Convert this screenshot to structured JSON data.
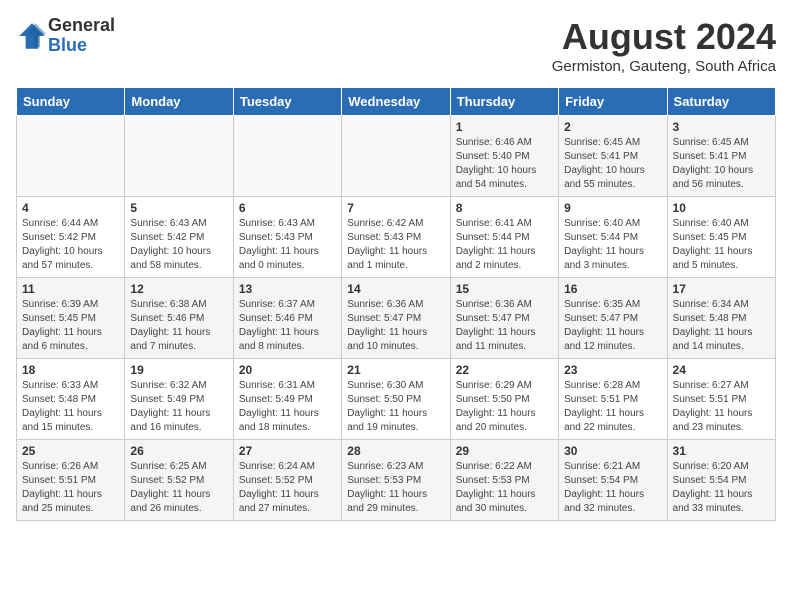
{
  "header": {
    "logo_general": "General",
    "logo_blue": "Blue",
    "month_year": "August 2024",
    "location": "Germiston, Gauteng, South Africa"
  },
  "days_of_week": [
    "Sunday",
    "Monday",
    "Tuesday",
    "Wednesday",
    "Thursday",
    "Friday",
    "Saturday"
  ],
  "weeks": [
    [
      {
        "day": "",
        "info": ""
      },
      {
        "day": "",
        "info": ""
      },
      {
        "day": "",
        "info": ""
      },
      {
        "day": "",
        "info": ""
      },
      {
        "day": "1",
        "info": "Sunrise: 6:46 AM\nSunset: 5:40 PM\nDaylight: 10 hours\nand 54 minutes."
      },
      {
        "day": "2",
        "info": "Sunrise: 6:45 AM\nSunset: 5:41 PM\nDaylight: 10 hours\nand 55 minutes."
      },
      {
        "day": "3",
        "info": "Sunrise: 6:45 AM\nSunset: 5:41 PM\nDaylight: 10 hours\nand 56 minutes."
      }
    ],
    [
      {
        "day": "4",
        "info": "Sunrise: 6:44 AM\nSunset: 5:42 PM\nDaylight: 10 hours\nand 57 minutes."
      },
      {
        "day": "5",
        "info": "Sunrise: 6:43 AM\nSunset: 5:42 PM\nDaylight: 10 hours\nand 58 minutes."
      },
      {
        "day": "6",
        "info": "Sunrise: 6:43 AM\nSunset: 5:43 PM\nDaylight: 11 hours\nand 0 minutes."
      },
      {
        "day": "7",
        "info": "Sunrise: 6:42 AM\nSunset: 5:43 PM\nDaylight: 11 hours\nand 1 minute."
      },
      {
        "day": "8",
        "info": "Sunrise: 6:41 AM\nSunset: 5:44 PM\nDaylight: 11 hours\nand 2 minutes."
      },
      {
        "day": "9",
        "info": "Sunrise: 6:40 AM\nSunset: 5:44 PM\nDaylight: 11 hours\nand 3 minutes."
      },
      {
        "day": "10",
        "info": "Sunrise: 6:40 AM\nSunset: 5:45 PM\nDaylight: 11 hours\nand 5 minutes."
      }
    ],
    [
      {
        "day": "11",
        "info": "Sunrise: 6:39 AM\nSunset: 5:45 PM\nDaylight: 11 hours\nand 6 minutes."
      },
      {
        "day": "12",
        "info": "Sunrise: 6:38 AM\nSunset: 5:46 PM\nDaylight: 11 hours\nand 7 minutes."
      },
      {
        "day": "13",
        "info": "Sunrise: 6:37 AM\nSunset: 5:46 PM\nDaylight: 11 hours\nand 8 minutes."
      },
      {
        "day": "14",
        "info": "Sunrise: 6:36 AM\nSunset: 5:47 PM\nDaylight: 11 hours\nand 10 minutes."
      },
      {
        "day": "15",
        "info": "Sunrise: 6:36 AM\nSunset: 5:47 PM\nDaylight: 11 hours\nand 11 minutes."
      },
      {
        "day": "16",
        "info": "Sunrise: 6:35 AM\nSunset: 5:47 PM\nDaylight: 11 hours\nand 12 minutes."
      },
      {
        "day": "17",
        "info": "Sunrise: 6:34 AM\nSunset: 5:48 PM\nDaylight: 11 hours\nand 14 minutes."
      }
    ],
    [
      {
        "day": "18",
        "info": "Sunrise: 6:33 AM\nSunset: 5:48 PM\nDaylight: 11 hours\nand 15 minutes."
      },
      {
        "day": "19",
        "info": "Sunrise: 6:32 AM\nSunset: 5:49 PM\nDaylight: 11 hours\nand 16 minutes."
      },
      {
        "day": "20",
        "info": "Sunrise: 6:31 AM\nSunset: 5:49 PM\nDaylight: 11 hours\nand 18 minutes."
      },
      {
        "day": "21",
        "info": "Sunrise: 6:30 AM\nSunset: 5:50 PM\nDaylight: 11 hours\nand 19 minutes."
      },
      {
        "day": "22",
        "info": "Sunrise: 6:29 AM\nSunset: 5:50 PM\nDaylight: 11 hours\nand 20 minutes."
      },
      {
        "day": "23",
        "info": "Sunrise: 6:28 AM\nSunset: 5:51 PM\nDaylight: 11 hours\nand 22 minutes."
      },
      {
        "day": "24",
        "info": "Sunrise: 6:27 AM\nSunset: 5:51 PM\nDaylight: 11 hours\nand 23 minutes."
      }
    ],
    [
      {
        "day": "25",
        "info": "Sunrise: 6:26 AM\nSunset: 5:51 PM\nDaylight: 11 hours\nand 25 minutes."
      },
      {
        "day": "26",
        "info": "Sunrise: 6:25 AM\nSunset: 5:52 PM\nDaylight: 11 hours\nand 26 minutes."
      },
      {
        "day": "27",
        "info": "Sunrise: 6:24 AM\nSunset: 5:52 PM\nDaylight: 11 hours\nand 27 minutes."
      },
      {
        "day": "28",
        "info": "Sunrise: 6:23 AM\nSunset: 5:53 PM\nDaylight: 11 hours\nand 29 minutes."
      },
      {
        "day": "29",
        "info": "Sunrise: 6:22 AM\nSunset: 5:53 PM\nDaylight: 11 hours\nand 30 minutes."
      },
      {
        "day": "30",
        "info": "Sunrise: 6:21 AM\nSunset: 5:54 PM\nDaylight: 11 hours\nand 32 minutes."
      },
      {
        "day": "31",
        "info": "Sunrise: 6:20 AM\nSunset: 5:54 PM\nDaylight: 11 hours\nand 33 minutes."
      }
    ]
  ]
}
